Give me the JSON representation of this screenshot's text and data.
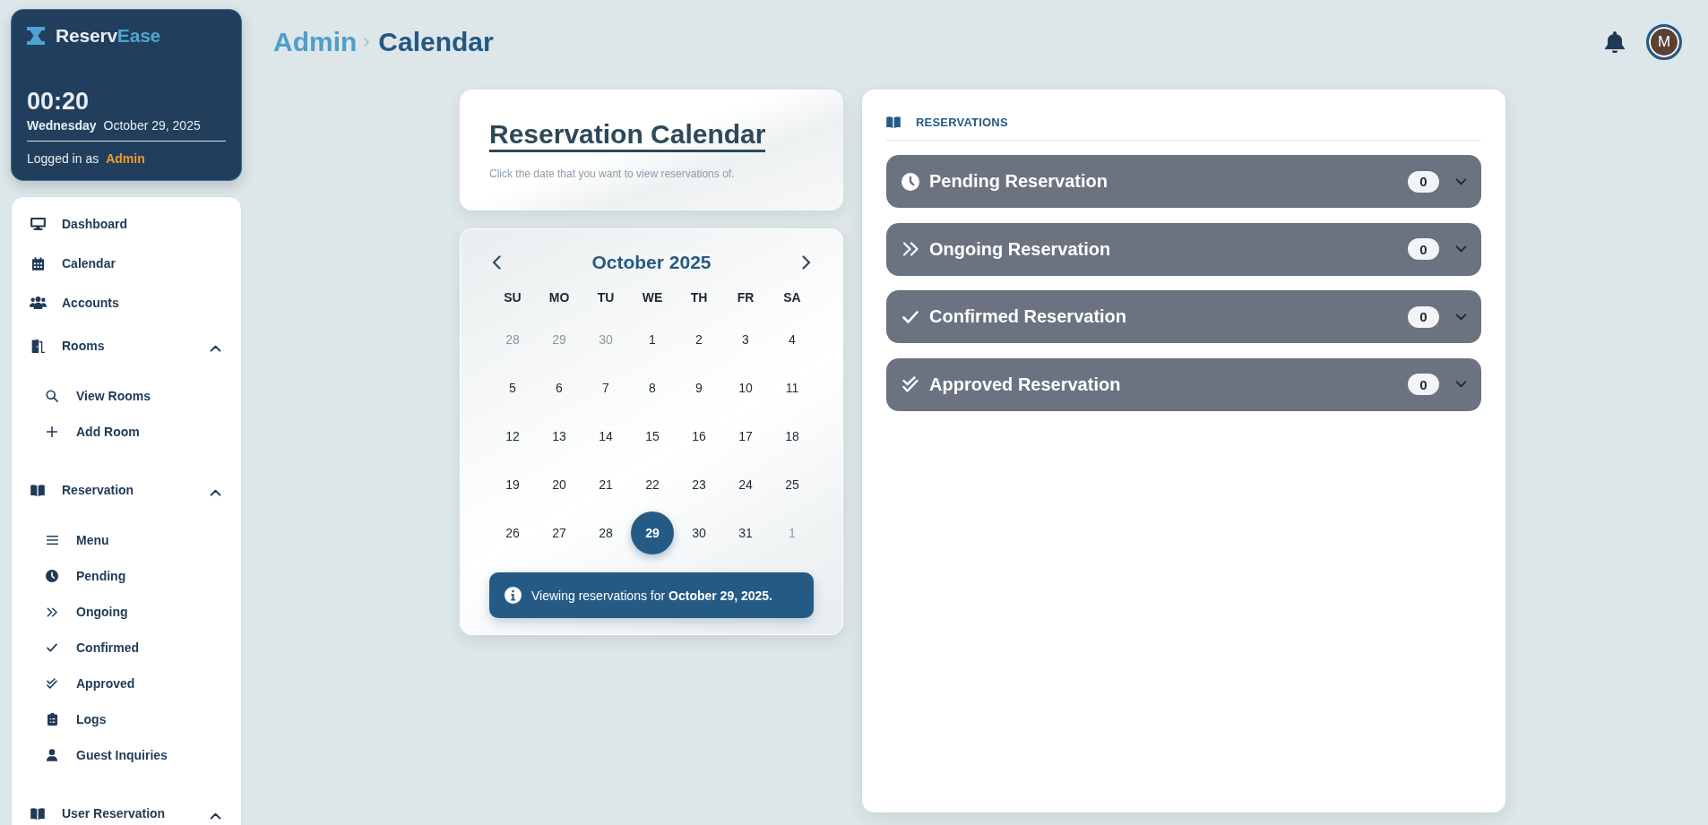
{
  "brand": {
    "name": "Reserv",
    "name_accent": "Ease"
  },
  "session": {
    "time": "00:20",
    "weekday": "Wednesday",
    "date": "October 29, 2025",
    "logged_in_label": "Logged in as",
    "user": "Admin"
  },
  "sidebar": {
    "items": [
      {
        "kind": "link",
        "label": "Dashboard"
      },
      {
        "kind": "link",
        "label": "Calendar"
      },
      {
        "kind": "link",
        "label": "Accounts"
      },
      {
        "kind": "group",
        "label": "Rooms",
        "expanded": true,
        "children": [
          {
            "label": "View Rooms"
          },
          {
            "label": "Add Room"
          }
        ]
      },
      {
        "kind": "group",
        "label": "Reservation",
        "expanded": true,
        "children": [
          {
            "label": "Menu"
          },
          {
            "label": "Pending"
          },
          {
            "label": "Ongoing"
          },
          {
            "label": "Confirmed"
          },
          {
            "label": "Approved"
          },
          {
            "label": "Logs"
          },
          {
            "label": "Guest Inquiries"
          }
        ]
      },
      {
        "kind": "group",
        "label": "User Reservation",
        "expanded": true
      }
    ]
  },
  "breadcrumb": [
    {
      "label": "Admin"
    },
    {
      "label": "Calendar"
    }
  ],
  "header": {
    "avatar_initial": "M"
  },
  "intro": {
    "title": "Reservation Calendar",
    "subtitle": "Click the date that you want to view reservations of."
  },
  "calendar": {
    "month": "October 2025",
    "weekdays": [
      "SU",
      "MO",
      "TU",
      "WE",
      "TH",
      "FR",
      "SA"
    ],
    "days": [
      {
        "label": "28",
        "other_month": true,
        "selected": false
      },
      {
        "label": "29",
        "other_month": true,
        "selected": false
      },
      {
        "label": "30",
        "other_month": true,
        "selected": false
      },
      {
        "label": "1",
        "other_month": false,
        "selected": false
      },
      {
        "label": "2",
        "other_month": false,
        "selected": false
      },
      {
        "label": "3",
        "other_month": false,
        "selected": false
      },
      {
        "label": "4",
        "other_month": false,
        "selected": false
      },
      {
        "label": "5",
        "other_month": false,
        "selected": false
      },
      {
        "label": "6",
        "other_month": false,
        "selected": false
      },
      {
        "label": "7",
        "other_month": false,
        "selected": false
      },
      {
        "label": "8",
        "other_month": false,
        "selected": false
      },
      {
        "label": "9",
        "other_month": false,
        "selected": false
      },
      {
        "label": "10",
        "other_month": false,
        "selected": false
      },
      {
        "label": "11",
        "other_month": false,
        "selected": false
      },
      {
        "label": "12",
        "other_month": false,
        "selected": false
      },
      {
        "label": "13",
        "other_month": false,
        "selected": false
      },
      {
        "label": "14",
        "other_month": false,
        "selected": false
      },
      {
        "label": "15",
        "other_month": false,
        "selected": false
      },
      {
        "label": "16",
        "other_month": false,
        "selected": false
      },
      {
        "label": "17",
        "other_month": false,
        "selected": false
      },
      {
        "label": "18",
        "other_month": false,
        "selected": false
      },
      {
        "label": "19",
        "other_month": false,
        "selected": false
      },
      {
        "label": "20",
        "other_month": false,
        "selected": false
      },
      {
        "label": "21",
        "other_month": false,
        "selected": false
      },
      {
        "label": "22",
        "other_month": false,
        "selected": false
      },
      {
        "label": "23",
        "other_month": false,
        "selected": false
      },
      {
        "label": "24",
        "other_month": false,
        "selected": false
      },
      {
        "label": "25",
        "other_month": false,
        "selected": false
      },
      {
        "label": "26",
        "other_month": false,
        "selected": false
      },
      {
        "label": "27",
        "other_month": false,
        "selected": false
      },
      {
        "label": "28",
        "other_month": false,
        "selected": false
      },
      {
        "label": "29",
        "other_month": false,
        "selected": true
      },
      {
        "label": "30",
        "other_month": false,
        "selected": false
      },
      {
        "label": "31",
        "other_month": false,
        "selected": false
      },
      {
        "label": "1",
        "other_month": true,
        "selected": false
      }
    ],
    "notice": "Viewing reservations for **October 29, 2025.**"
  },
  "reservations": {
    "title": "RESERVATIONS",
    "groups": [
      {
        "label": "Pending Reservation",
        "count": "0",
        "expanded": false
      },
      {
        "label": "Ongoing Reservation",
        "count": "0",
        "expanded": false
      },
      {
        "label": "Confirmed Reservation",
        "count": "0",
        "expanded": false
      },
      {
        "label": "Approved Reservation",
        "count": "0",
        "expanded": false
      }
    ]
  }
}
